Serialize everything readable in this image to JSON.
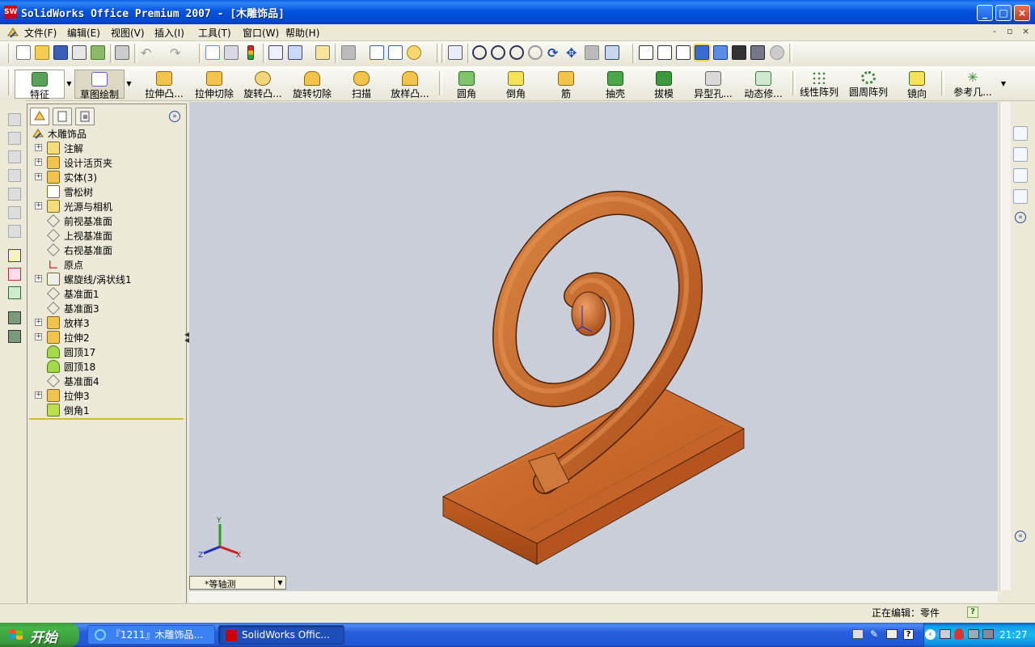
{
  "window": {
    "title": "SolidWorks Office Premium 2007 - [木雕饰品]",
    "logo_text": "SW",
    "controls": [
      "_",
      "□",
      "×"
    ]
  },
  "menu": {
    "items": [
      "文件(F)",
      "编辑(E)",
      "视图(V)",
      "插入(I)",
      "工具(T)",
      "窗口(W)",
      "帮助(H)"
    ],
    "doc_controls": [
      "-",
      "▫",
      "×"
    ]
  },
  "command_manager": {
    "tabs": [
      "特征",
      "草图绘制"
    ],
    "buttons": [
      "拉伸凸...",
      "拉伸切除",
      "旋转凸...",
      "旋转切除",
      "扫描",
      "放样凸...",
      "圆角",
      "倒角",
      "筋",
      "抽壳",
      "拔模",
      "异型孔...",
      "动态修...",
      "线性阵列",
      "圆周阵列",
      "镜向",
      "参考几..."
    ]
  },
  "feature_tree": {
    "root": "木雕饰品",
    "items": [
      {
        "label": "注解",
        "expand": "+",
        "icon": "annotation-icon"
      },
      {
        "label": "设计活页夹",
        "expand": "+",
        "icon": "design-binder-icon"
      },
      {
        "label": "实体(3)",
        "expand": "+",
        "icon": "solid-bodies-icon"
      },
      {
        "label": "雪松树",
        "expand": "",
        "icon": "material-icon"
      },
      {
        "label": "光源与相机",
        "expand": "+",
        "icon": "lights-cameras-icon"
      },
      {
        "label": "前视基准面",
        "expand": "",
        "icon": "plane-icon"
      },
      {
        "label": "上视基准面",
        "expand": "",
        "icon": "plane-icon"
      },
      {
        "label": "右视基准面",
        "expand": "",
        "icon": "plane-icon"
      },
      {
        "label": "原点",
        "expand": "",
        "icon": "origin-icon"
      },
      {
        "label": "螺旋线/涡状线1",
        "expand": "+",
        "icon": "helix-icon"
      },
      {
        "label": "基准面1",
        "expand": "",
        "icon": "plane-icon"
      },
      {
        "label": "基准面3",
        "expand": "",
        "icon": "plane-icon"
      },
      {
        "label": "放样3",
        "expand": "+",
        "icon": "loft-icon"
      },
      {
        "label": "拉伸2",
        "expand": "+",
        "icon": "extrude-icon"
      },
      {
        "label": "圆顶17",
        "expand": "",
        "icon": "dome-icon"
      },
      {
        "label": "圆顶18",
        "expand": "",
        "icon": "dome-icon"
      },
      {
        "label": "基准面4",
        "expand": "",
        "icon": "plane-icon"
      },
      {
        "label": "拉伸3",
        "expand": "+",
        "icon": "extrude-icon"
      },
      {
        "label": "倒角1",
        "expand": "",
        "icon": "chamfer-icon"
      }
    ]
  },
  "viewport": {
    "view_name": "*等轴测",
    "background": "#C9CED8",
    "wood_color": "#C8672A",
    "triad": {
      "x": "X",
      "y": "Y",
      "z": "Z"
    }
  },
  "status": {
    "text": "正在编辑：零件",
    "help": "?"
  },
  "taskbar": {
    "start": "开始",
    "tasks": [
      "『1211』木雕饰品...",
      "SolidWorks Offic..."
    ],
    "clock": "21:27"
  }
}
